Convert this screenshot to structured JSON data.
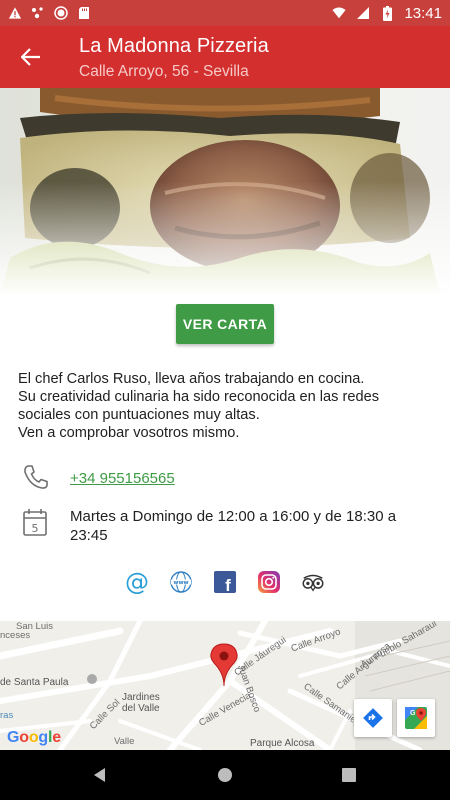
{
  "status_bar": {
    "time": "13:41",
    "left_icons": [
      "warning-icon",
      "notification-dots-icon",
      "record-icon",
      "sd-card-icon"
    ],
    "right_icons": [
      "wifi-icon",
      "signal-icon",
      "battery-charging-icon"
    ]
  },
  "app_bar": {
    "title": "La Madonna Pizzeria",
    "subtitle": "Calle Arroyo, 56 - Sevilla",
    "back_icon": "arrow-back-icon"
  },
  "hero": {
    "image": "burger-photo"
  },
  "menu_button": {
    "label": "VER CARTA"
  },
  "description": {
    "lines": [
      "El chef Carlos Ruso, lleva años trabajando en cocina.",
      "Su creatividad culinaria ha sido reconocida en las redes",
      "sociales con puntuaciones muy altas.",
      "Ven a comprobar vosotros mismo."
    ]
  },
  "contact": {
    "phone": "+34 955156565",
    "hours_line1": "Martes a Domingo de 12:00 a 16:00 y de 18:30 a",
    "hours_line2": "23:45"
  },
  "social": [
    "email-icon",
    "website-icon",
    "facebook-icon",
    "instagram-icon",
    "tripadvisor-icon"
  ],
  "map": {
    "labels": {
      "san_luis": "San Luis",
      "franceses": "nceses",
      "santa_paula": "de Santa Paula",
      "ras": "ras",
      "jardines1": "Jardines",
      "jardines2": "del Valle",
      "calle_arroyo": "Calle Arroyo",
      "calle_jaurequi": "Calle Jáuregui",
      "av_pueblo": "Av. Pueblo Saharaui",
      "calle_arguelles": "Calle Argumosa",
      "calle_samaniego": "Calle Samaniego",
      "juan_bosco": "Juan Bosco",
      "calle_venecia": "Calle Venecia",
      "calle_sol": "Calle Sol",
      "parque": "Parque Alcosa",
      "valle": "Valle"
    },
    "google_logo": [
      "G",
      "o",
      "o",
      "g",
      "l",
      "e"
    ],
    "google_colors": [
      "#4285F4",
      "#EA4335",
      "#FBBC05",
      "#4285F4",
      "#34A853",
      "#EA4335"
    ],
    "pin_color": "#e53935"
  },
  "colors": {
    "status_bar": "#c8403c",
    "app_bar": "#d32f2f",
    "button": "#3f9b46",
    "link": "#3f9b46"
  }
}
